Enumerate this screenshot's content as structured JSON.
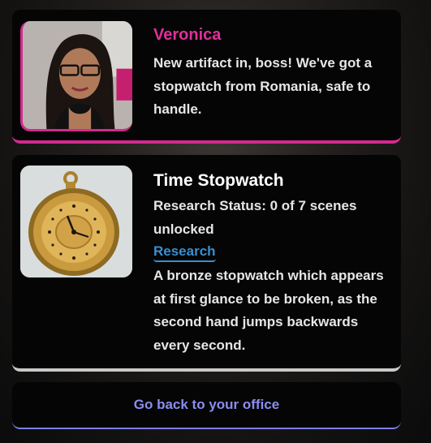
{
  "message": {
    "speaker": "Veronica",
    "text": "New artifact in, boss! We've got a stopwatch from Romania, safe to handle.",
    "accent_color": "#d22a8e"
  },
  "item": {
    "title": "Time Stopwatch",
    "status": "Research Status: 0 of 7 scenes unlocked",
    "research_link": "Research",
    "description": "A bronze stopwatch which appears at first glance to be broken, as the second hand jumps backwards every second."
  },
  "navigation": {
    "back_label": "Go back to your office",
    "accent_color": "#7b7fe8"
  }
}
